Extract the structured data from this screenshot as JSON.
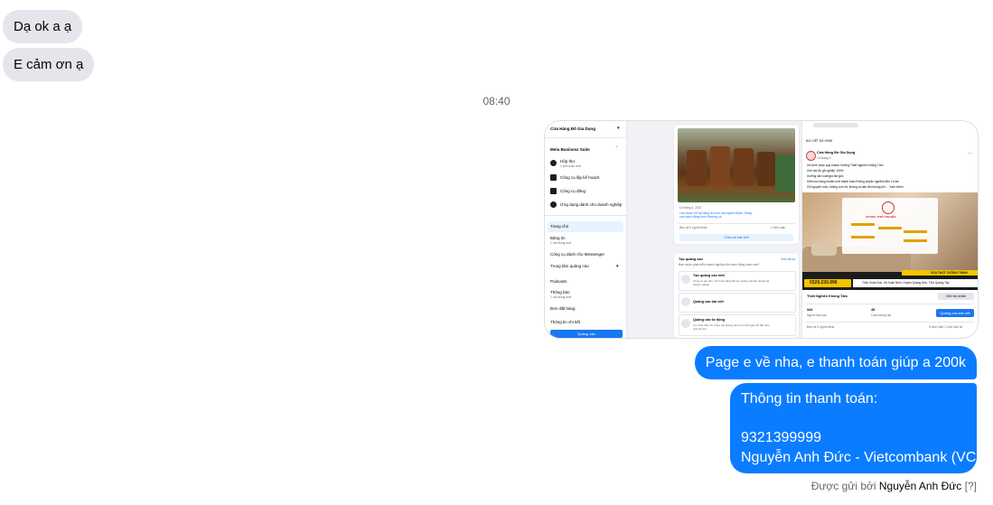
{
  "messages": {
    "incoming": [
      "Dạ ok a ạ",
      "E cảm ơn ạ"
    ],
    "timestamp": "08:40",
    "outgoing_1": "Page e về nha, e thanh toán giúp a 200k",
    "outgoing_2": {
      "line1": "Thông tin thanh toán:",
      "line2": "9321399999",
      "line3": "Nguyễn Anh Đức - Vietcombank (VCB)"
    }
  },
  "footer": {
    "sent_by": "Được gửi bởi",
    "sender": "Nguyễn Anh Đức",
    "help": "[?]"
  },
  "shared_image": {
    "page_name": "Cửa Hàng Đồ Gia Dụng",
    "suite": "Meta Business Suite",
    "sidebar": [
      {
        "label": "Hộp thư",
        "sub": "1 tinh luận mới"
      },
      {
        "label": "Công cụ lập kế hoạch",
        "sub": ""
      },
      {
        "label": "Công cụ đăng",
        "sub": ""
      },
      {
        "label": "Ứng dụng dành cho doanh nghiệp",
        "sub": ""
      }
    ],
    "nav": [
      {
        "label": "Trang chủ",
        "sub": ""
      },
      {
        "label": "Bảng tin",
        "sub": "1 nội dung mới"
      },
      {
        "label": "Công cụ dành cho Messenger",
        "sub": ""
      },
      {
        "label": "Trung tâm quảng cáo",
        "sub": ""
      },
      {
        "label": "Podcasts",
        "sub": ""
      },
      {
        "label": "Thông báo",
        "sub": "1 nội dung mới"
      },
      {
        "label": "Đơn đặt hàng",
        "sub": ""
      },
      {
        "label": "Thông tin chi tiết",
        "sub": ""
      }
    ],
    "sidebar_button": "Quảng cáo",
    "post_date": "11 tháng 4, 2021",
    "post_caption": "Lâu muộn trở lại đồng lên cho mọi người thăm. Sàng cần hành động bình thường ok",
    "post_reach": "Bạn và 5 người khác",
    "post_comments": "1 bình luận",
    "post_boost": "Chia sẻ bài viết",
    "ads_title": "Tạo quảng cáo",
    "ads_link": "Xem tất cả",
    "ads_sub": "Bạn muốn phát triển doanh nghiệp của mình bằng cách nào?",
    "ads_options": [
      {
        "title": "Tạo quảng cáo mới",
        "desc": "Công cụ tạo đơn, lịch hoạt động để tạo quảng cáo để quảng bá doanh nghiệp"
      },
      {
        "title": "Quảng cáo bài viết",
        "desc": ""
      },
      {
        "title": "Quảng cáo tự động",
        "desc": "Có nhận hiển thị, khảo sát quảng cáo theo thời gian để đạt hiệu quả tốt hơn"
      }
    ],
    "pinned_label": "BÀI VIẾT ĐÃ GHIM",
    "pinned_page": "Cửa Hàng Đồ Gia Dụng",
    "pinned_date": "15 tháng 4",
    "pinned_text": [
      "Xin kính chào quý khách Xưởng Thiết Nghiên Không Tâm",
      "Chế tác đồ gỗ nghiệp 100%",
      "Xưởng sản xuất giá tận gốc",
      "Kiểm tra hàng chuẩn mới thanh toán Không chuẩn nghiệm đến 10 lần",
      "Gỗ nguyên mộc, không sơn lót, không ra dầu ẩm không khí ... Xem thêm"
    ],
    "banner_phone": "0329.230.996",
    "banner_address": "Thôn Xuân Dục, Xã Xuân Nình, Huyện Quảng Sơn, Tỉnh Quảng Tây",
    "banner_brand": "XƯỞNG THIẾT NGHIỆN",
    "banner_tag": "VỰA THỢT CƯỜNG THỊNH",
    "shop_name": "Thiết Nghiên Không Tâm",
    "shop_send": "Gửi tin nhắn",
    "stat1_value": "344",
    "stat1_label": "Người tiếp cận",
    "stat2_value": "45",
    "stat2_label": "Lượt tương tác",
    "promote_button": "Quảng cáo bài viết",
    "pinned_reach": "Bạn và 6 người khác",
    "pinned_stats": "5 bình luận    1 lượt chia sẻ",
    "colors": {
      "accent": "#1877f2",
      "bubble_out": "#0a7cff",
      "bubble_in": "#e4e6eb",
      "banner_yellow": "#f5c400"
    }
  }
}
